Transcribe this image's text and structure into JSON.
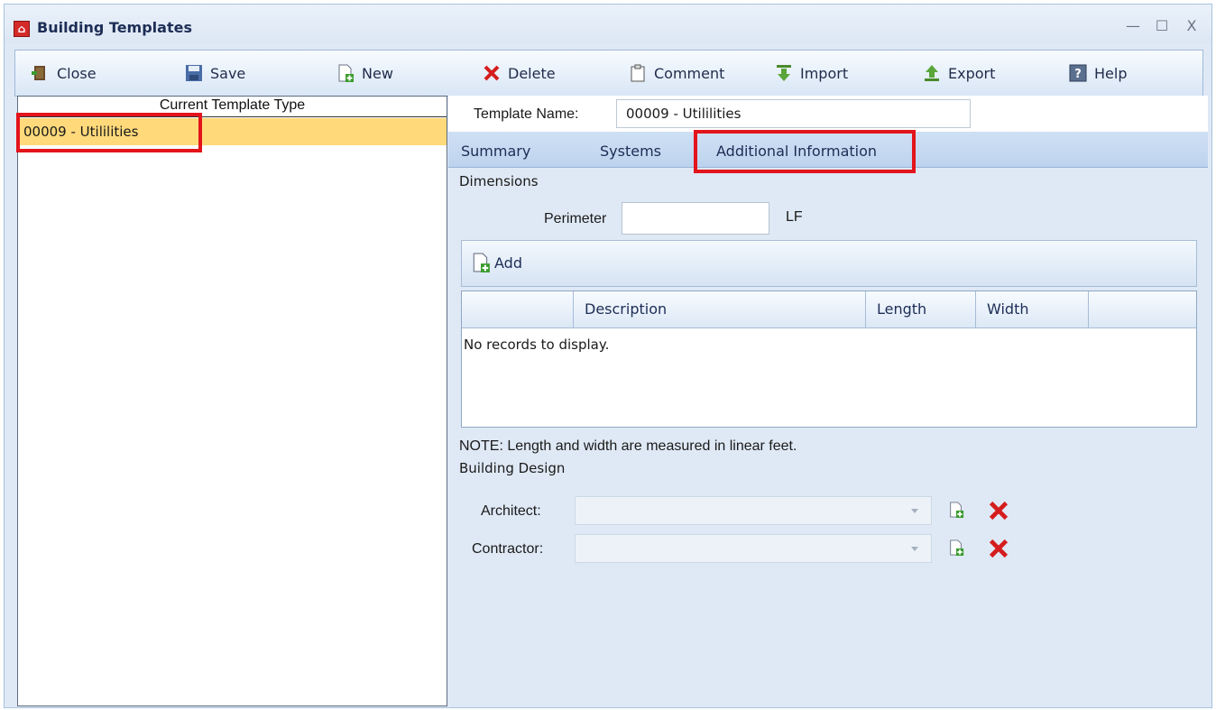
{
  "window": {
    "title": "Building Templates",
    "controls": {
      "minimize": "—",
      "maximize": "☐",
      "close": "X"
    }
  },
  "toolbar": {
    "close": "Close",
    "save": "Save",
    "new": "New",
    "delete": "Delete",
    "comment": "Comment",
    "import": "Import",
    "export": "Export",
    "help": "Help"
  },
  "left_panel": {
    "header": "Current Template Type",
    "items": [
      {
        "label": "00009 - Utililities",
        "selected": true
      }
    ]
  },
  "template": {
    "name_label": "Template Name:",
    "name_value": "00009 - Utililities"
  },
  "tabs": [
    {
      "label": "Summary"
    },
    {
      "label": "Systems"
    },
    {
      "label": "Additional Information",
      "active": true
    }
  ],
  "dimensions": {
    "section_title": "Dimensions",
    "perimeter_label": "Perimeter",
    "perimeter_value": "",
    "perimeter_unit": "LF",
    "add_label": "Add",
    "grid": {
      "columns": [
        "",
        "Description",
        "Length",
        "Width",
        ""
      ],
      "empty_text": "No records to display."
    },
    "note": "NOTE: Length and width are measured in linear feet."
  },
  "building_design": {
    "section_title": "Building Design",
    "architect_label": "Architect:",
    "architect_value": "",
    "contractor_label": "Contractor:",
    "contractor_value": ""
  },
  "colors": {
    "selection": "#ffd97a",
    "highlight_box": "#e3141b",
    "delete_x": "#d51d1d"
  }
}
